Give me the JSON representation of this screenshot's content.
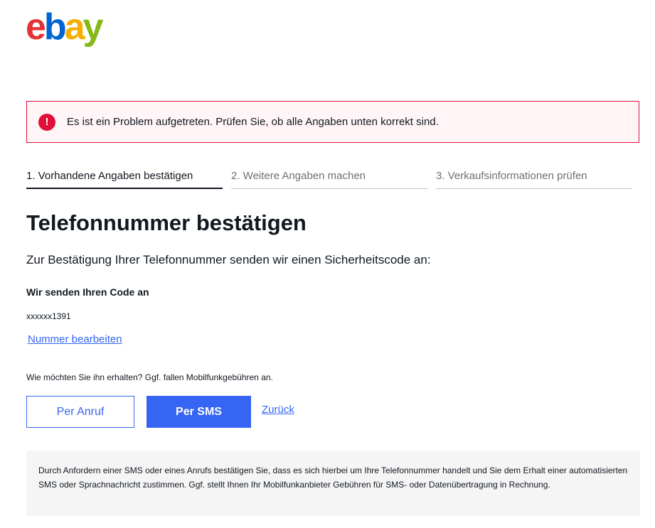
{
  "logo": {
    "letters": [
      "e",
      "b",
      "a",
      "y"
    ],
    "colors": [
      "#e53238",
      "#0064d2",
      "#f5af02",
      "#86b817"
    ]
  },
  "alert": {
    "icon": "exclamation-icon",
    "icon_glyph": "!",
    "message": "Es ist ein Problem aufgetreten. Prüfen Sie, ob alle Angaben unten korrekt sind."
  },
  "steps": [
    {
      "label": "1. Vorhandene Angaben bestätigen",
      "active": true
    },
    {
      "label": "2. Weitere Angaben machen",
      "active": false
    },
    {
      "label": "3. Verkaufsinformationen prüfen",
      "active": false
    }
  ],
  "page": {
    "title": "Telefonnummer bestätigen",
    "intro": "Zur Bestätigung Ihrer Telefonnummer senden wir einen Sicherheitscode an:",
    "send_label": "Wir senden Ihren Code an",
    "phone": "xxxxxx1391",
    "edit_link": "Nummer bearbeiten",
    "question": "Wie möchten Sie ihn erhalten? Ggf. fallen Mobilfunkgebühren an.",
    "call_button": "Per Anruf",
    "sms_button": "Per SMS",
    "back_link": "Zurück",
    "disclaimer": "Durch Anfordern einer SMS oder eines Anrufs bestätigen Sie, dass es sich hierbei um Ihre Telefonnummer handelt und Sie dem Erhalt einer automatisierten SMS oder Sprachnachricht zustimmen. Ggf. stellt Ihnen Ihr Mobilfunkanbieter Gebühren für SMS- oder Datenübertragung in Rechnung."
  },
  "colors": {
    "accent": "#3665f3",
    "error": "#e0103a",
    "error_bg": "#fff5f7"
  }
}
